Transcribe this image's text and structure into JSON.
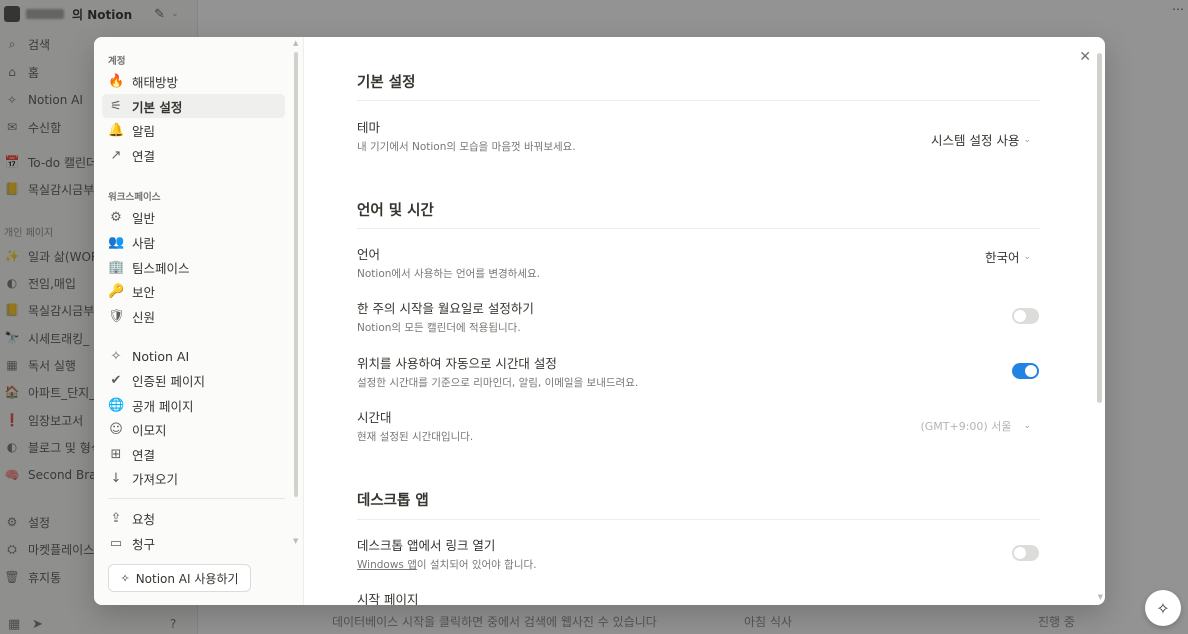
{
  "background": {
    "workspace_name": "의 Notion",
    "nav": [
      {
        "icon": "⌕",
        "label": "검색"
      },
      {
        "icon": "⌂",
        "label": "홈"
      },
      {
        "icon": "✧",
        "label": "Notion AI"
      },
      {
        "icon": "✉",
        "label": "수신함"
      }
    ],
    "pages_top": [
      {
        "icon": "📅",
        "label": "To-do 캘린더"
      },
      {
        "icon": "📒",
        "label": "목실감시금부"
      }
    ],
    "section_personal": "개인 페이지",
    "pages_personal": [
      {
        "icon": "✨",
        "label": "일과 삶(WORK)"
      },
      {
        "icon": "◐",
        "label": "전임,매입"
      },
      {
        "icon": "📒",
        "label": "목실감시금부"
      },
      {
        "icon": "🔭",
        "label": "시세트래킹_"
      },
      {
        "icon": "▦",
        "label": "독서 실행"
      },
      {
        "icon": "🏠",
        "label": "아파트_단지_"
      },
      {
        "icon": "❗",
        "label": "임장보고서"
      },
      {
        "icon": "◐",
        "label": "블로그 및 형식"
      },
      {
        "icon": "🧠",
        "label": "Second Brain"
      }
    ],
    "bottom_nav": [
      {
        "icon": "⚙",
        "label": "설정"
      },
      {
        "icon": "⛭",
        "label": "마켓플레이스"
      },
      {
        "icon": "🗑",
        "label": "휴지통"
      }
    ],
    "bottom_text_left": "데이터베이스 시작을 클릭하면 중에서 검색에 웹사진 수 있습니다",
    "bottom_text_mid": "아침 식사",
    "bottom_text_right": "진행 중"
  },
  "settings_sidebar": {
    "section_account": "계정",
    "account_items": [
      {
        "icon": "🔥",
        "label": "해태방방"
      },
      {
        "icon": "⚟",
        "label": "기본 설정"
      },
      {
        "icon": "🔔",
        "label": "알림"
      },
      {
        "icon": "↗",
        "label": "연결"
      }
    ],
    "section_workspace": "워크스페이스",
    "workspace_items": [
      {
        "icon": "⚙",
        "label": "일반"
      },
      {
        "icon": "👥",
        "label": "사람"
      },
      {
        "icon": "🏢",
        "label": "팀스페이스"
      },
      {
        "icon": "🔑",
        "label": "보안"
      },
      {
        "icon": "🛡",
        "label": "신원"
      },
      {
        "icon": "✧",
        "label": "Notion AI"
      },
      {
        "icon": "✔",
        "label": "인증된 페이지"
      },
      {
        "icon": "🌐",
        "label": "공개 페이지"
      },
      {
        "icon": "☺",
        "label": "이모지"
      },
      {
        "icon": "⊞",
        "label": "연결"
      },
      {
        "icon": "↓",
        "label": "가져오기"
      }
    ],
    "extra_items": [
      {
        "icon": "⇪",
        "label": "요청"
      },
      {
        "icon": "▭",
        "label": "청구"
      }
    ],
    "ai_button_label": "Notion AI 사용하기"
  },
  "settings_main": {
    "section_basic": "기본 설정",
    "theme_title": "테마",
    "theme_desc": "내 기기에서 Notion의 모습을 마음껏 바꿔보세요.",
    "theme_value": "시스템 설정 사용",
    "section_lang": "언어 및 시간",
    "lang_title": "언어",
    "lang_desc": "Notion에서 사용하는 언어를 변경하세요.",
    "lang_value": "한국어",
    "week_title": "한 주의 시작을 월요일로 설정하기",
    "week_desc": "Notion의 모든 캘린더에 적용됩니다.",
    "week_on": false,
    "auto_tz_title": "위치를 사용하여 자동으로 시간대 설정",
    "auto_tz_desc": "설정한 시간대를 기준으로 리마인더, 알림, 이메일을 보내드려요.",
    "auto_tz_on": true,
    "tz_title": "시간대",
    "tz_desc": "현재 설정된 시간대입니다.",
    "tz_value": "(GMT+9:00) 서울",
    "section_desktop": "데스크톱 앱",
    "open_links_title": "데스크톱 앱에서 링크 열기",
    "open_links_desc_link": "Windows 앱",
    "open_links_desc_rest": "이 설치되어 있어야 합니다.",
    "open_links_on": false,
    "start_page_title": "시작 페이지"
  },
  "colors": {
    "accent": "#2383e2",
    "toggle_off": "#dcdcda"
  }
}
